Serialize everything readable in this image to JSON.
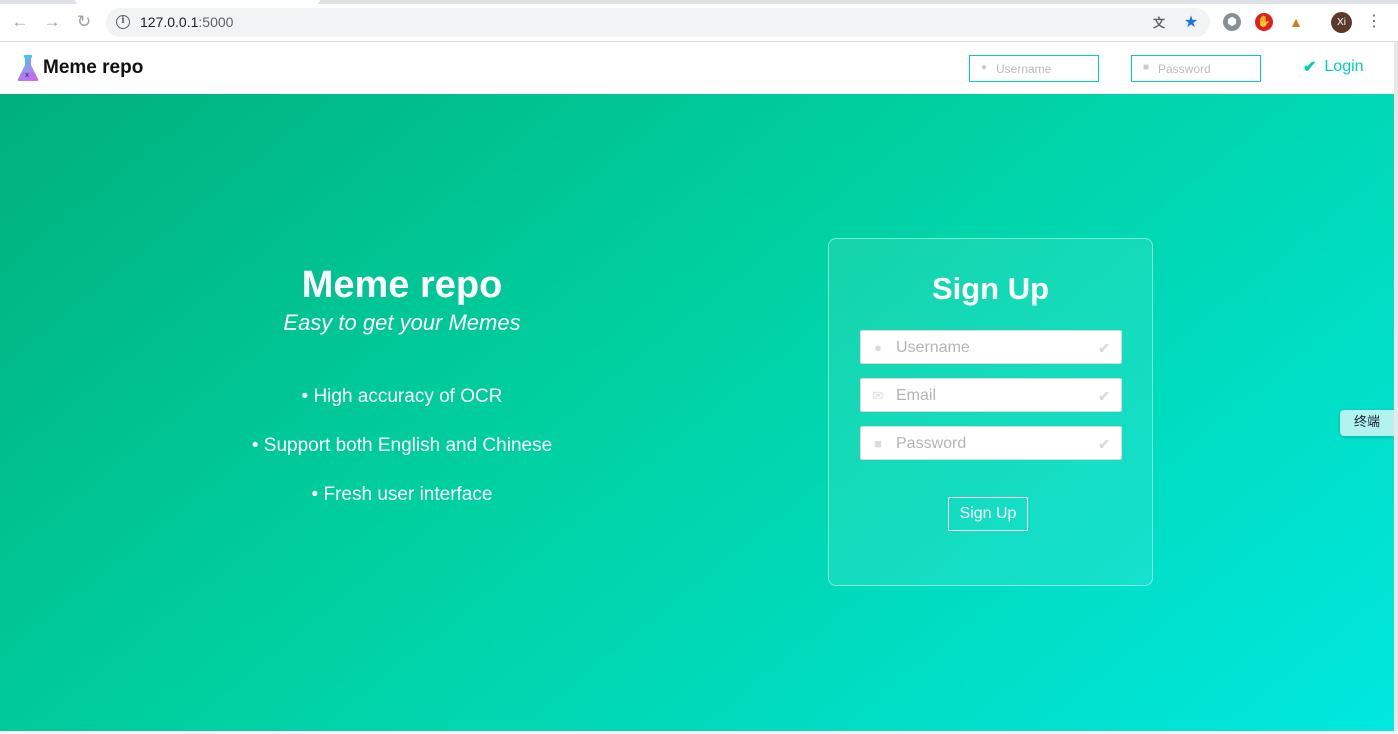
{
  "browser": {
    "url_host": "127.0.0.1",
    "url_port": ":5000",
    "avatar_initials": "Xi"
  },
  "header": {
    "brand": "Meme repo",
    "username_placeholder": "Username",
    "password_placeholder": "Password",
    "login_label": "Login",
    "accent_color": "#00d1b2"
  },
  "hero": {
    "title": "Meme repo",
    "subtitle": "Easy to get your Memes",
    "features": [
      "• High accuracy of OCR",
      "• Support both English and Chinese",
      "• Fresh user interface"
    ]
  },
  "signup": {
    "title": "Sign Up",
    "username_placeholder": "Username",
    "email_placeholder": "Email",
    "password_placeholder": "Password",
    "button_label": "Sign Up"
  },
  "side_tab": {
    "label": "终端"
  }
}
